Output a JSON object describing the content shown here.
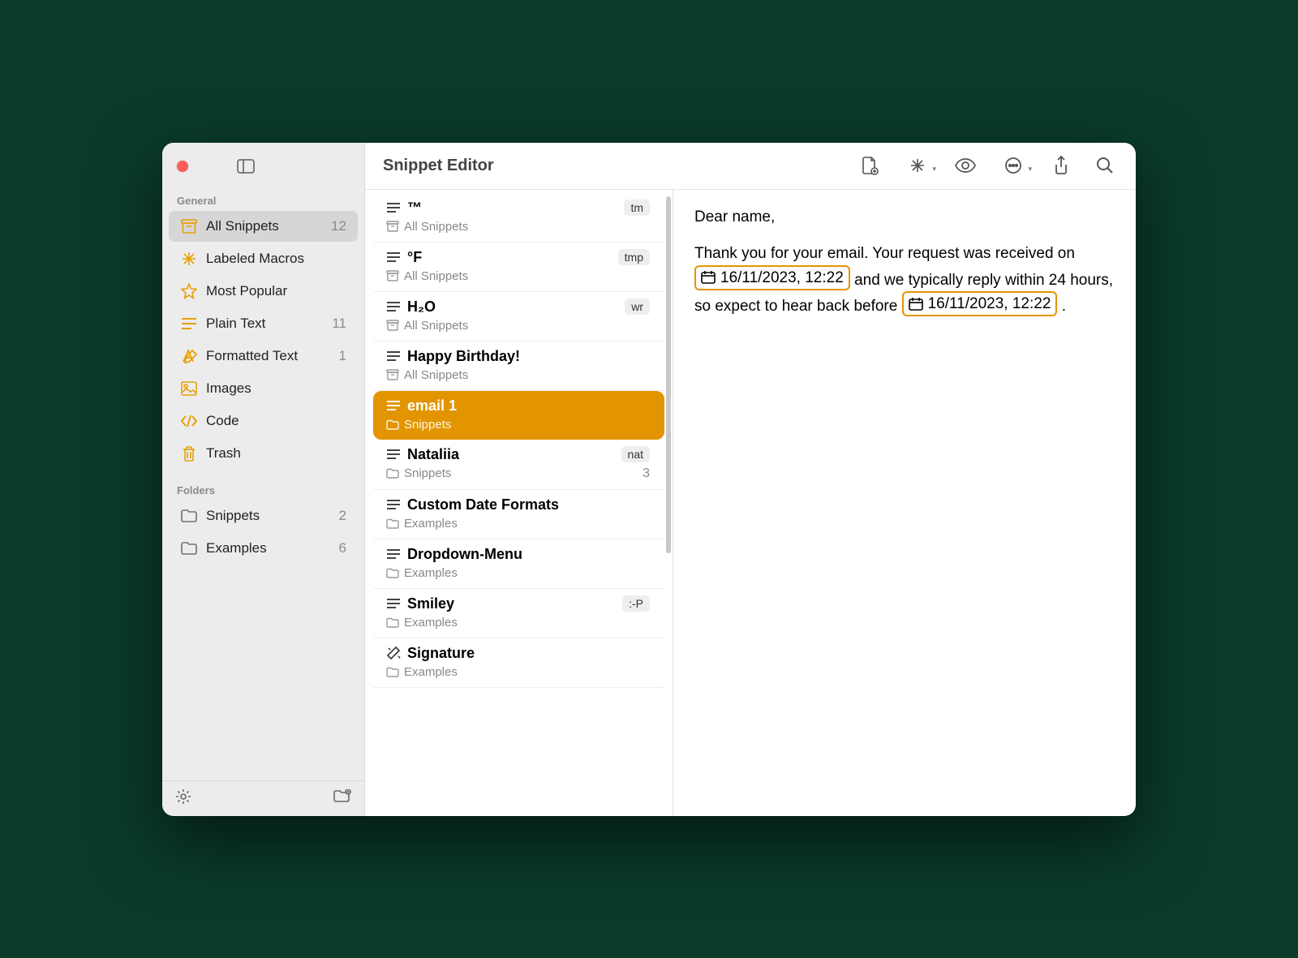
{
  "header": {
    "title": "Snippet Editor"
  },
  "sidebar": {
    "sections": {
      "general_label": "General",
      "folders_label": "Folders"
    },
    "general": [
      {
        "label": "All Snippets",
        "count": "12"
      },
      {
        "label": "Labeled Macros",
        "count": ""
      },
      {
        "label": "Most Popular",
        "count": ""
      },
      {
        "label": "Plain Text",
        "count": "11"
      },
      {
        "label": "Formatted Text",
        "count": "1"
      },
      {
        "label": "Images",
        "count": ""
      },
      {
        "label": "Code",
        "count": ""
      },
      {
        "label": "Trash",
        "count": ""
      }
    ],
    "folders": [
      {
        "label": "Snippets",
        "count": "2"
      },
      {
        "label": "Examples",
        "count": "6"
      }
    ]
  },
  "snippets": [
    {
      "title": "™",
      "folder": "All Snippets",
      "tag": "tm",
      "type": "text"
    },
    {
      "title": "°F",
      "folder": "All Snippets",
      "tag": "tmp",
      "type": "text"
    },
    {
      "title": "H₂O",
      "folder": "All Snippets",
      "tag": "wr",
      "type": "text"
    },
    {
      "title": "Happy Birthday!",
      "folder": "All Snippets",
      "tag": "",
      "type": "text"
    },
    {
      "title": "email 1",
      "folder": "Snippets",
      "tag": "",
      "type": "text",
      "selected": true
    },
    {
      "title": "Nataliia",
      "folder": "Snippets",
      "tag": "nat",
      "count": "3",
      "type": "text"
    },
    {
      "title": "Custom Date Formats",
      "folder": "Examples",
      "tag": "",
      "type": "text"
    },
    {
      "title": "Dropdown-Menu",
      "folder": "Examples",
      "tag": "",
      "type": "text"
    },
    {
      "title": "Smiley",
      "folder": "Examples",
      "tag": ":-P",
      "type": "text"
    },
    {
      "title": "Signature",
      "folder": "Examples",
      "tag": "",
      "type": "formatted"
    }
  ],
  "preview": {
    "greeting": "Dear name,",
    "body_before_date1": "Thank you for your email. Your request was received on ",
    "date1": "16/11/2023, 12:22",
    "body_mid": " and we typically reply within 24 hours, so expect to hear back before ",
    "date2": "16/11/2023, 12:22",
    "body_after": "."
  }
}
